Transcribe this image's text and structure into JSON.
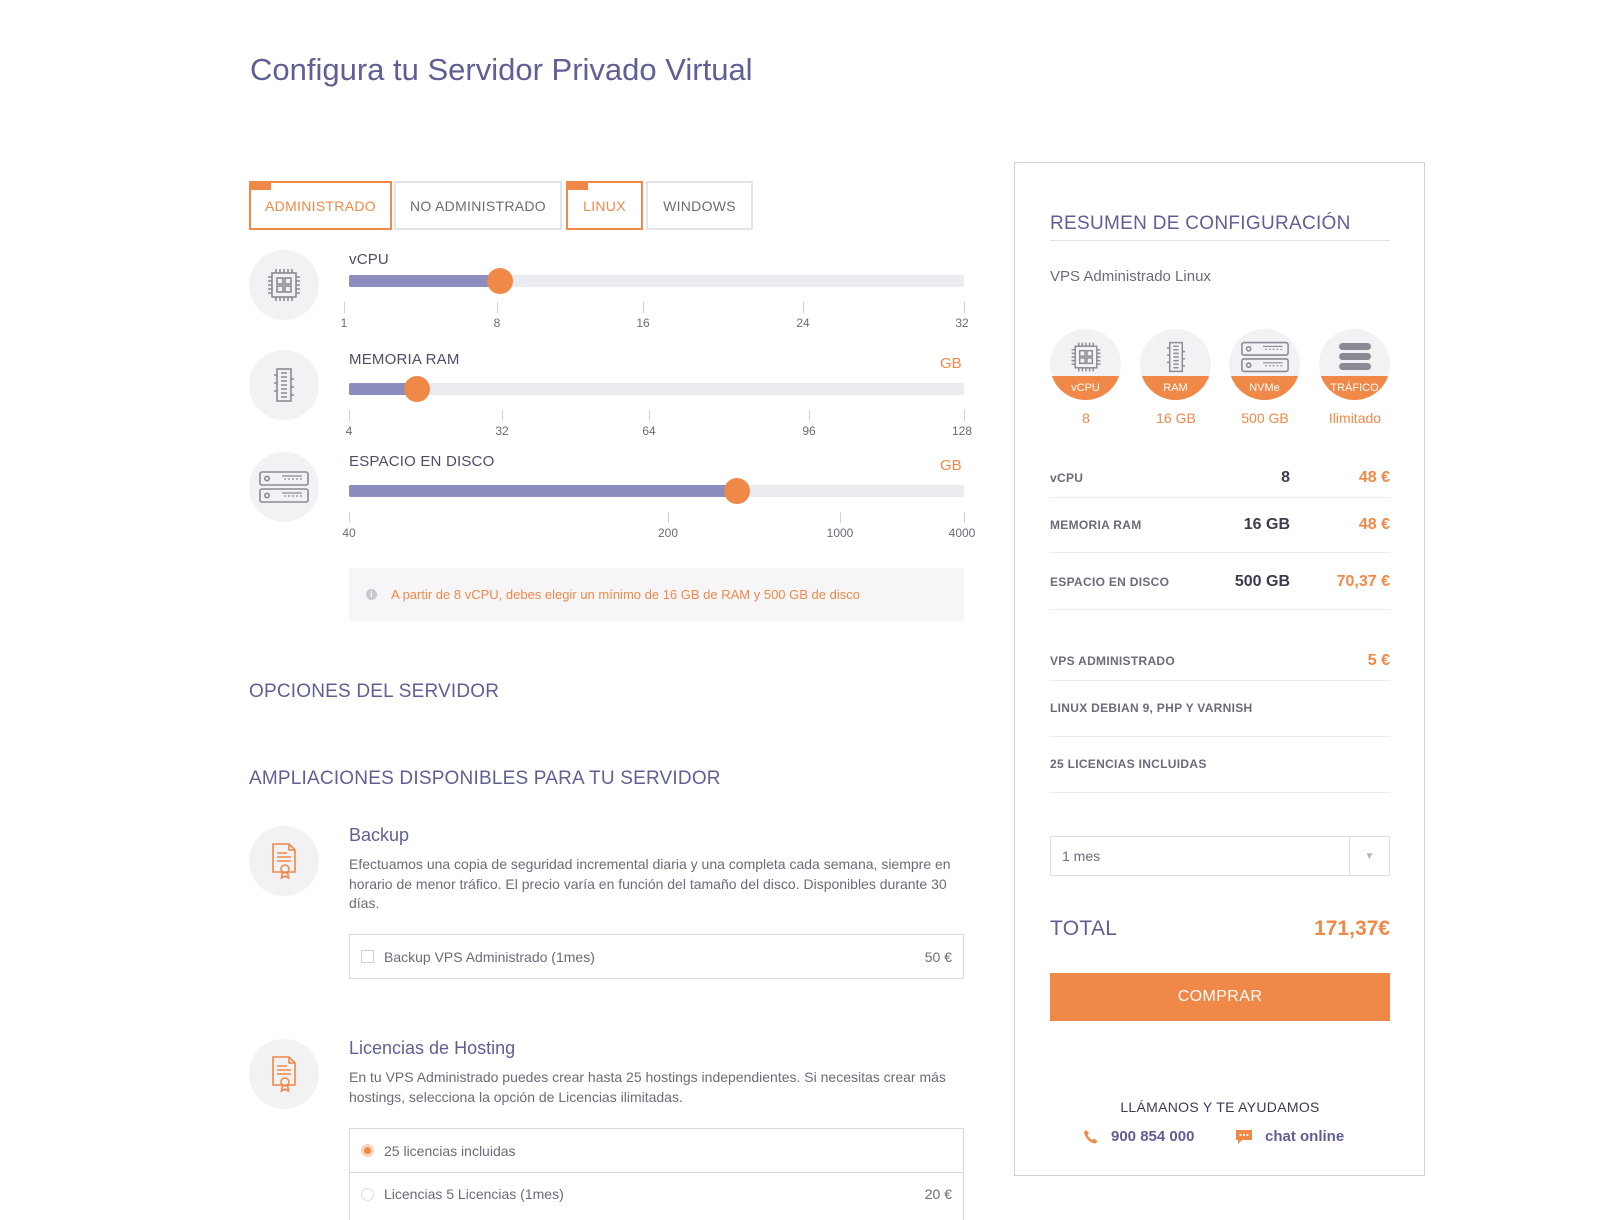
{
  "page": {
    "title": "Configura tu Servidor Privado Virtual"
  },
  "tabs": [
    {
      "label": "ADMINISTRADO",
      "active": true
    },
    {
      "label": "NO ADMINISTRADO",
      "active": false
    },
    {
      "label": "LINUX",
      "active": true
    },
    {
      "label": "WINDOWS",
      "active": false
    }
  ],
  "sliders": {
    "vcpu": {
      "label": "vCPU",
      "unit": "",
      "value": 8,
      "ticks": [
        "1",
        "8",
        "16",
        "24",
        "32"
      ]
    },
    "ram": {
      "label": "MEMORIA RAM",
      "unit": "GB",
      "value": 16,
      "ticks": [
        "4",
        "32",
        "64",
        "96",
        "128"
      ]
    },
    "disk": {
      "label": "ESPACIO EN DISCO",
      "unit": "GB",
      "value": 500,
      "ticks": [
        "40",
        "200",
        "1000",
        "4000"
      ]
    }
  },
  "notice": "A partir de 8 vCPU, debes elegir un mínimo de 16 GB de RAM y 500 GB de disco",
  "sections": {
    "options": "OPCIONES DEL SERVIDOR",
    "addons": "AMPLIACIONES DISPONIBLES PARA TU SERVIDOR"
  },
  "addons": {
    "backup": {
      "title": "Backup",
      "description": "Efectuamos una copia de seguridad incremental diaria y una completa cada semana, siempre en horario de menor tráfico. El precio varía en función del tamaño del disco. Disponibles durante 30 días.",
      "options": [
        {
          "label": "Backup VPS Administrado (1mes)",
          "price": "50 €",
          "checked": false
        }
      ]
    },
    "licenses": {
      "title": "Licencias de Hosting",
      "description": "En tu VPS Administrado puedes crear hasta 25 hostings independientes. Si necesitas crear más hostings, selecciona la opción de Licencias ilimitadas.",
      "options": [
        {
          "label": "25 licencias incluidas",
          "price": "",
          "selected": true
        },
        {
          "label": "Licencias 5 Licencias (1mes)",
          "price": "20 €",
          "selected": false
        }
      ]
    }
  },
  "summary": {
    "title": "RESUMEN DE CONFIGURACIÓN",
    "subtitle": "VPS Administrado Linux",
    "resources": [
      {
        "label": "vCPU",
        "value": "8",
        "icon": "cpu-icon"
      },
      {
        "label": "RAM",
        "value": "16 GB",
        "icon": "ram-icon"
      },
      {
        "label": "NVMe",
        "value": "500 GB",
        "icon": "server-icon"
      },
      {
        "label": "TRÁFICO",
        "value": "Ilimitado",
        "icon": "database-icon"
      }
    ],
    "rows": [
      {
        "key": "vCPU",
        "value": "8",
        "price": "48 €"
      },
      {
        "key": "MEMORIA RAM",
        "value": "16 GB",
        "price": "48 €"
      },
      {
        "key": "ESPACIO EN DISCO",
        "value": "500 GB",
        "price": "70,37 €"
      }
    ],
    "extras": [
      {
        "key": "VPS ADMINISTRADO",
        "price": "5 €"
      },
      {
        "key": "LINUX DEBIAN 9, PHP Y VARNISH",
        "price": ""
      },
      {
        "key": "25 LICENCIAS INCLUIDAS",
        "price": ""
      }
    ],
    "period": "1 mes",
    "total_label": "TOTAL",
    "total_value": "171,37€",
    "buy_label": "COMPRAR",
    "help": "LLÁMANOS Y TE AYUDAMOS",
    "phone": "900 854 000",
    "chat": "chat online"
  },
  "colors": {
    "accent": "#f08848",
    "primary": "#5f5f95",
    "slider_fill": "#8c8cbe"
  }
}
